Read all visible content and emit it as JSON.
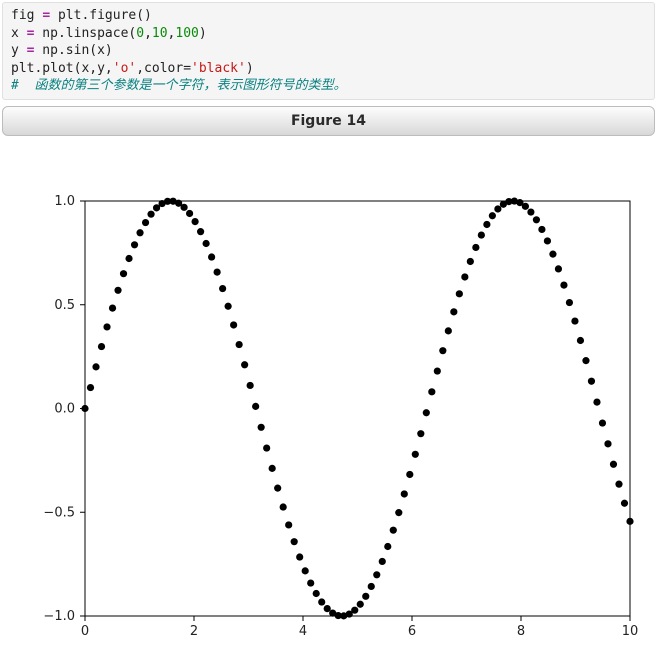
{
  "code": {
    "line1": {
      "t1": "fig ",
      "op": "=",
      "t2": " plt.figure()"
    },
    "line2": {
      "t1": "x ",
      "op": "=",
      "t2": " np.linspace(",
      "n1": "0",
      "c1": ",",
      "n2": "10",
      "c2": ",",
      "n3": "100",
      "t3": ")"
    },
    "line3": {
      "t1": "y ",
      "op": "=",
      "t2": " np.sin(x)"
    },
    "line4": {
      "t1": "plt.plot(x,y,",
      "s1": "'o'",
      "t2": ",color=",
      "s2": "'black'",
      "t3": ")"
    },
    "line5": "#  函数的第三个参数是一个字符，表示图形符号的类型。"
  },
  "titlebar": "Figure 14",
  "chart_data": {
    "type": "scatter",
    "marker": "o",
    "color": "black",
    "x_range": [
      0,
      10
    ],
    "n_points": 100,
    "formula": "y = sin(x)",
    "xticks": [
      0,
      2,
      4,
      6,
      8,
      10
    ],
    "yticks": [
      -1.0,
      -0.5,
      0.0,
      0.5,
      1.0
    ],
    "xlim": [
      0,
      10
    ],
    "ylim": [
      -1.0,
      1.0
    ],
    "title": "",
    "xlabel": "",
    "ylabel": ""
  }
}
